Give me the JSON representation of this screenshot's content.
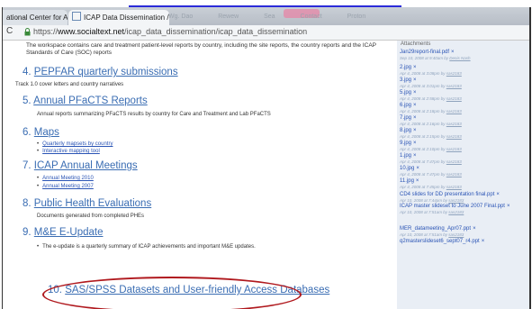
{
  "browser": {
    "tabs": [
      {
        "label": "ational Center for AID",
        "active": false
      },
      {
        "label": "ICAP Data Dissemination /",
        "active": true
      }
    ],
    "background_tabs": [
      "Wg. Dao",
      "Rewew",
      "Sea",
      "Contact",
      "Proton"
    ],
    "address": {
      "scheme": "https://",
      "host": "www.socialtext.net",
      "path": "/icap_data_dissemination/icap_data_dissemination"
    }
  },
  "main": {
    "intro": "The workspace contains care and treatment patient-level reports by country, including the site reports, the country reports and the ICAP Standards of Care (SOC) reports",
    "sections": [
      {
        "num": "4.",
        "title": "PEPFAR quarterly submissions",
        "description": "Track 1.0 cover letters and country narratives"
      },
      {
        "num": "5.",
        "title": "Annual PFaCTS Reports",
        "description": "Annual reports summarizing PFaCTS results by country for Care and Treatment and Lab PFaCTS"
      },
      {
        "num": "6.",
        "title": "Maps",
        "links": [
          "Quarterly mapsets by country",
          "Interactive mapping tool"
        ]
      },
      {
        "num": "7.",
        "title": "ICAP Annual Meetings",
        "links": [
          "Annual Meeting 2010",
          "Annual Meeting 2007"
        ]
      },
      {
        "num": "8.",
        "title": "Public Health Evaluations",
        "description": "Documents generated from completed PHEs"
      },
      {
        "num": "9.",
        "title": "M&E E-Update",
        "bullet": "The e-update is a quarterly summary of ICAP achievements and important M&E updates."
      },
      {
        "num": "10.",
        "title": "SAS/SPSS Datasets and User-friendly Access Databases"
      }
    ]
  },
  "sidebar": {
    "heading": "Attachments",
    "attachments": [
      {
        "file": "Jan29report-final.pdf",
        "date": "Sep 10, 2008 at 9:40am",
        "user": "Denis Nash"
      },
      {
        "file": "2.jpg",
        "date": "Apr 4, 2008 at 3:08pm",
        "user": "sas2183"
      },
      {
        "file": "3.jpg",
        "date": "Apr 4, 2008 at 3:01pm",
        "user": "sas2183"
      },
      {
        "file": "5.jpg",
        "date": "Apr 4, 2008 at 2:58pm",
        "user": "sas2183"
      },
      {
        "file": "6.jpg",
        "date": "Apr 4, 2008 at 2:18pm",
        "user": "sas2183"
      },
      {
        "file": "7.jpg",
        "date": "Apr 4, 2008 at 2:16pm",
        "user": "sas2183"
      },
      {
        "file": "8.jpg",
        "date": "Apr 4, 2008 at 2:15pm",
        "user": "sas2183"
      },
      {
        "file": "9.jpg",
        "date": "Apr 4, 2008 at 2:10pm",
        "user": "sas2183"
      },
      {
        "file": "1.jpg",
        "date": "Apr 4, 2008 at 7:47pm",
        "user": "sas2183"
      },
      {
        "file": "10.jpg",
        "date": "Apr 4, 2008 at 7:47pm",
        "user": "sas2183"
      },
      {
        "file": "11.jpg",
        "date": "Apr 4, 2008 at 7:45pm",
        "user": "sas2183"
      },
      {
        "file": "CD4 slides for DD presentation final.ppt",
        "date": "Apr 10, 2008 at 7:44pm",
        "user": "sas2183"
      },
      {
        "file": "ICAP master slideset to June 2007 Final.ppt",
        "date": "Apr 10, 2008 at 7:51am",
        "user": "sas2183"
      },
      {
        "file": "MER_datameeting_Apr07.ppt",
        "date": "Apr 10, 2008 at 7:51am",
        "user": "sas2183"
      },
      {
        "file": "q2masterslideset6_sept07_r4.ppt",
        "date": "",
        "user": ""
      }
    ]
  }
}
